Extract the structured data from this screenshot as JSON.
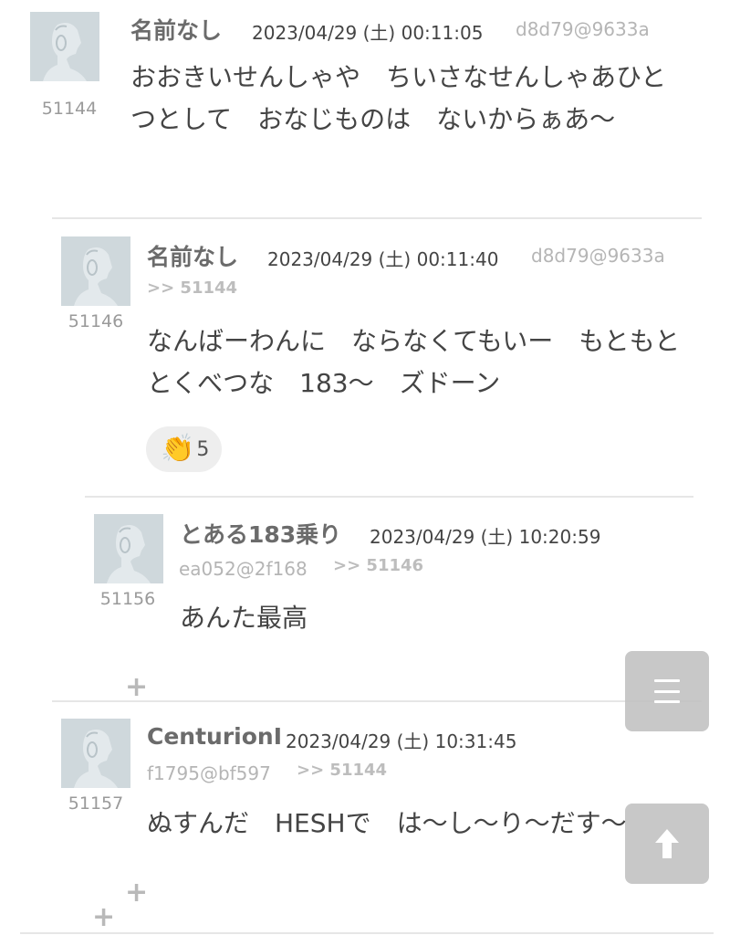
{
  "posts": [
    {
      "number": "51144",
      "name": "名前なし",
      "date": "2023/04/29 (土) 00:11:05",
      "uid": "d8d79@9633a",
      "body": "おおきいせんしゃや　ちいさなせんしゃあひとつとして　おなじものは　ないからぁあ〜"
    },
    {
      "number": "51146",
      "name": "名前なし",
      "date": "2023/04/29 (土) 00:11:40",
      "uid": "d8d79@9633a",
      "reply_ref": ">> 51144",
      "body": "なんばーわんに　ならなくてもいー　もともと　とくべつな　183〜　ズドーン",
      "reaction": {
        "icon": "clapping-hands-icon",
        "emoji": "👏",
        "count": "5"
      }
    },
    {
      "number": "51156",
      "name": "とある183乗り",
      "date": "2023/04/29 (土) 10:20:59",
      "uid": "ea052@2f168",
      "reply_ref": ">> 51146",
      "body": "あんた最高"
    },
    {
      "number": "51157",
      "name": "CenturionI",
      "date": "2023/04/29 (土) 10:31:45",
      "uid": "f1795@bf597",
      "reply_ref": ">> 51144",
      "body": "ぬすんだ　HESHで　は〜し〜り〜だす〜"
    }
  ],
  "controls": {
    "expand_symbol": "+",
    "menu_icon": "hamburger-menu-icon",
    "scroll_top_icon": "arrow-up-icon"
  },
  "colors": {
    "avatar_bg": "#cfd8dc",
    "name": "#6b6b6b",
    "uid": "#b5b5b5",
    "divider": "#e6e6e6",
    "float_button": "#bebebe"
  }
}
